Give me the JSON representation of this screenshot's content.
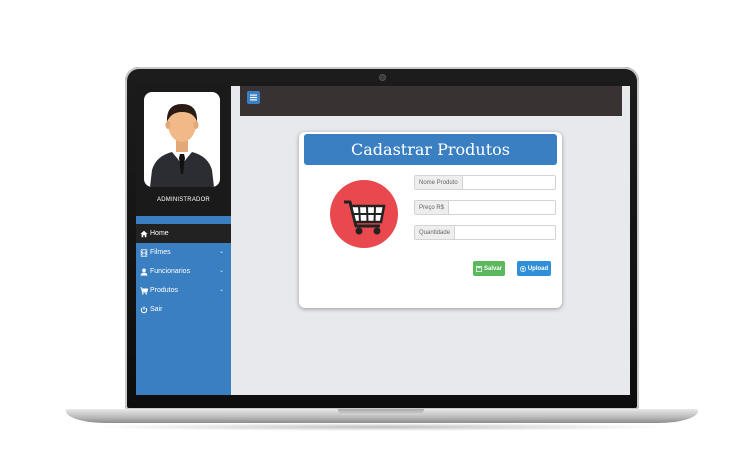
{
  "sidebar": {
    "admin_name": "ADMINISTRADOR",
    "items": [
      {
        "label": "Home",
        "icon": "home-icon",
        "active": true
      },
      {
        "label": "Filmes",
        "icon": "film-icon",
        "has_submenu": true
      },
      {
        "label": "Funcionarios",
        "icon": "user-icon",
        "has_submenu": true
      },
      {
        "label": "Produtos",
        "icon": "cart-icon",
        "has_submenu": true
      },
      {
        "label": "Sair",
        "icon": "power-icon"
      }
    ]
  },
  "form": {
    "title": "Cadastrar Produtos",
    "fields": [
      {
        "label": "Nome Produto",
        "value": ""
      },
      {
        "label": "Preço R$",
        "value": ""
      },
      {
        "label": "Quantidade",
        "value": ""
      }
    ],
    "save_label": "Salvar",
    "upload_label": "Upload"
  },
  "colors": {
    "primary": "#3a7fc1",
    "topbar": "#383232",
    "success": "#5cb85c",
    "info": "#2f8fd8",
    "cart_circle": "#e8484e",
    "background": "#e7e9ec"
  }
}
